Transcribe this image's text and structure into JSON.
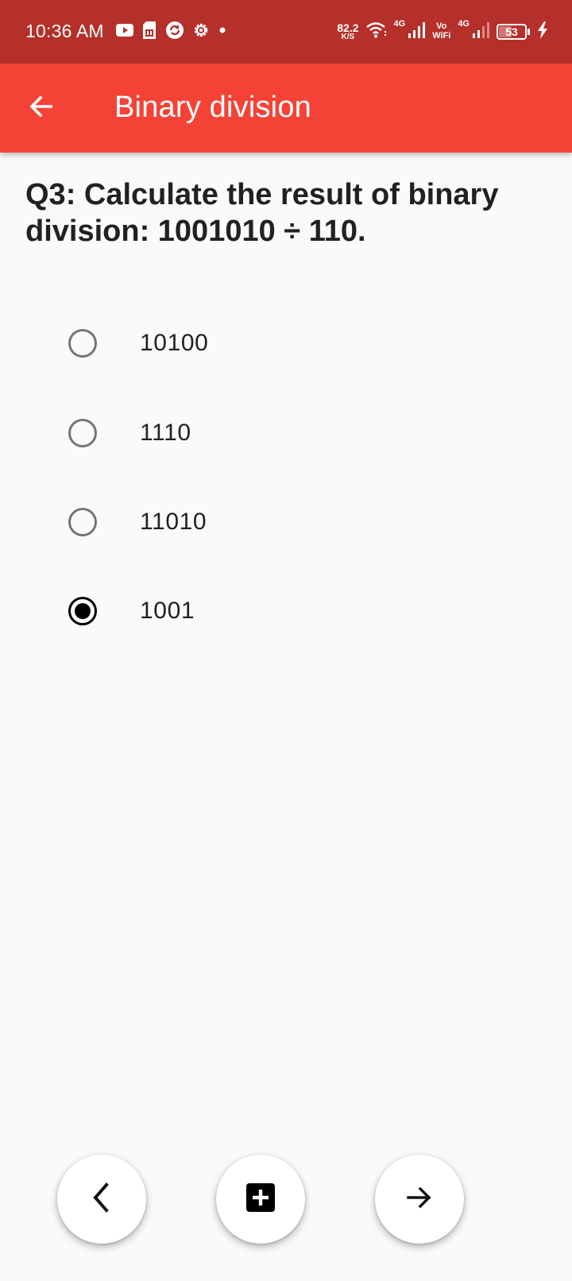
{
  "status_bar": {
    "time": "10:36 AM",
    "icons_left": [
      "youtube-icon",
      "sim-card-icon",
      "sync-icon",
      "gear-icon",
      "dot-icon"
    ],
    "speed_value": "82.2",
    "speed_unit": "K/S",
    "network_label_1": "4G",
    "vowifi_top": "Vo",
    "vowifi_bottom": "WiFi",
    "network_label_2": "4G",
    "battery_level": "53",
    "battery_fraction": 0.53,
    "charging": true,
    "color": "#b5302a"
  },
  "app_bar": {
    "title": "Binary division",
    "back_icon": "arrow-left-icon",
    "color": "#f44336"
  },
  "question": {
    "text": "Q3: Calculate the result of binary division: 1001010 ÷ 110."
  },
  "options": [
    {
      "label": "10100",
      "selected": false
    },
    {
      "label": "1110",
      "selected": false
    },
    {
      "label": "11010",
      "selected": false
    },
    {
      "label": "1001",
      "selected": true
    }
  ],
  "bottom_bar": {
    "buttons": [
      {
        "name": "previous-button",
        "icon": "chevron-left-icon"
      },
      {
        "name": "add-button",
        "icon": "plus-box-icon"
      },
      {
        "name": "next-button",
        "icon": "arrow-right-icon"
      }
    ]
  }
}
